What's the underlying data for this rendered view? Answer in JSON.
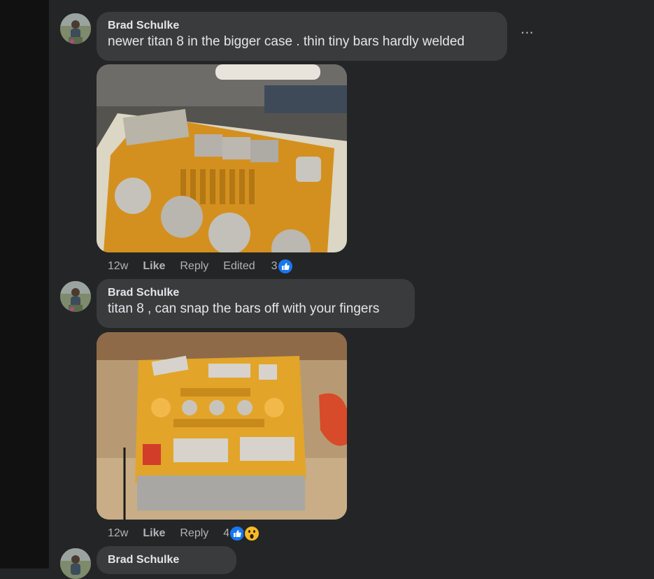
{
  "comments": [
    {
      "author": "Brad Schulke",
      "text": "newer titan 8 in the bigger case . thin tiny bars hardly welded",
      "time": "12w",
      "like_label": "Like",
      "reply_label": "Reply",
      "edited_label": "Edited",
      "reaction_count": "3",
      "reactions": [
        "like-icon"
      ],
      "more_label": "···"
    },
    {
      "author": "Brad Schulke",
      "text": "titan 8 , can snap the bars off with your fingers",
      "time": "12w",
      "like_label": "Like",
      "reply_label": "Reply",
      "reaction_count": "4",
      "reactions": [
        "like-icon",
        "wow-icon"
      ]
    },
    {
      "author": "Brad Schulke"
    }
  ],
  "colors": {
    "background": "#242526",
    "bubble": "#3a3b3c",
    "text": "#e4e6eb",
    "secondary_text": "#b0b3b8",
    "like_blue": "#1877f2",
    "wow_yellow": "#f7b928"
  }
}
